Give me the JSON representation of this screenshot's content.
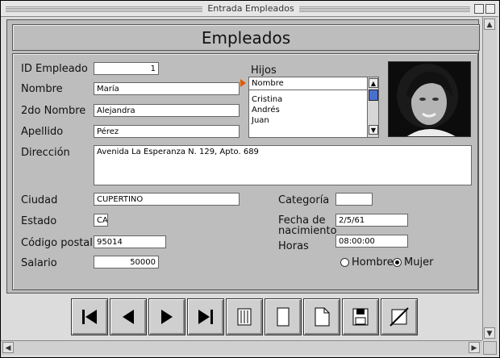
{
  "window": {
    "title": "Entrada Empleados"
  },
  "form": {
    "header": "Empleados"
  },
  "labels": {
    "id_empleado": "ID Empleado",
    "nombre": "Nombre",
    "segundo_nombre": "2do Nombre",
    "apellido": "Apellido",
    "direccion": "Dirección",
    "ciudad": "Ciudad",
    "estado": "Estado",
    "codigo_postal": "Código postal",
    "salario": "Salario",
    "hijos": "Hijos",
    "categoria": "Categoría",
    "fecha_nacimiento_l1": "Fecha de",
    "fecha_nacimiento_l2": "nacimiento",
    "horas": "Horas"
  },
  "values": {
    "id_empleado": "1",
    "nombre": "María",
    "segundo_nombre": "Alejandra",
    "apellido": "Pérez",
    "direccion": "Avenida La Esperanza N. 129, Apto. 689",
    "ciudad": "CUPERTINO",
    "estado": "CA",
    "codigo_postal": "95014",
    "salario": "50000",
    "categoria": "",
    "fecha_nacimiento": "2/5/61",
    "horas": "08:00:00"
  },
  "hijos_list": {
    "header": "Nombre",
    "items": [
      "Cristina",
      "Andrés",
      "Juan"
    ]
  },
  "sexo": {
    "hombre": "Hombre",
    "mujer": "Mujer",
    "selected": "mujer"
  },
  "icons": {
    "nav": [
      "first-record-icon",
      "previous-record-icon",
      "next-record-icon",
      "last-record-icon",
      "delete-icon",
      "new-record-icon",
      "duplicate-icon",
      "save-icon",
      "cancel-icon"
    ]
  }
}
